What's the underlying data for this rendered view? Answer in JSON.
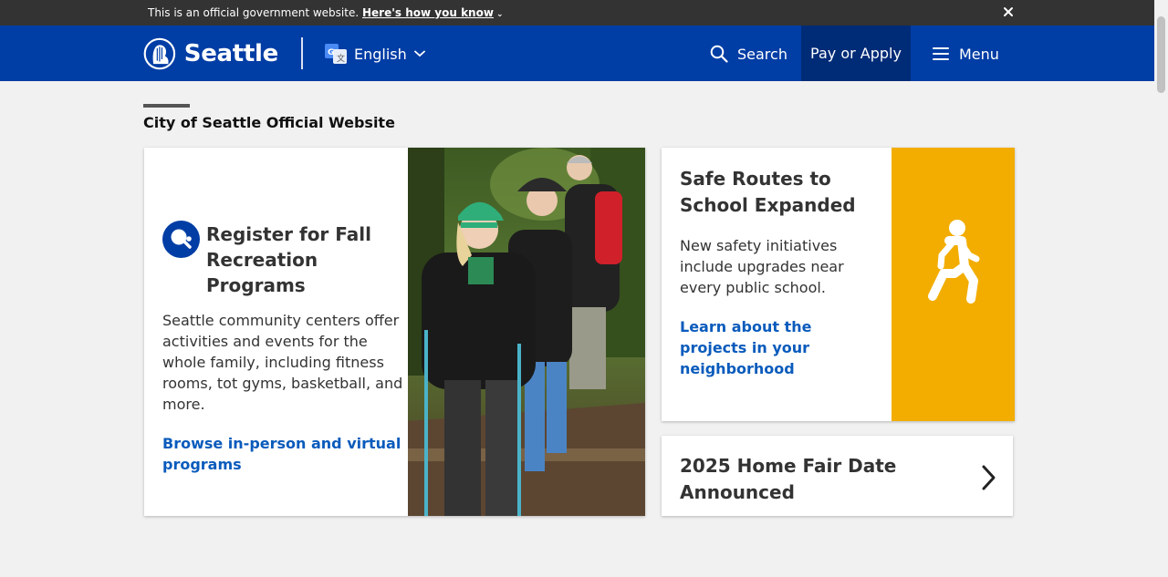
{
  "gov_banner": {
    "text": "This is an official government website.",
    "link": "Here's how you know",
    "chevron_icon": "chevron-down-icon",
    "close_icon": "close-icon"
  },
  "header": {
    "logo_text": "Seattle",
    "language": "English",
    "search_label": "Search",
    "pay_label": "Pay or Apply",
    "menu_label": "Menu"
  },
  "page": {
    "title": "City of Seattle Official Website"
  },
  "features": {
    "main": {
      "icon": "ping-pong-icon",
      "title": "Register for Fall Recreation Programs",
      "body": "Seattle community centers offer activities and events for the whole family, including fitness rooms, tot gyms, basketball, and more.",
      "link": "Browse in-person and virtual programs"
    },
    "safe_routes": {
      "title": "Safe Routes to School Expanded",
      "body": "New safety initiatives include upgrades near every public school.",
      "link": "Learn about the projects in your neighborhood",
      "icon": "walking-person-icon"
    },
    "home_fair": {
      "title": "2025 Home Fair Date Announced",
      "icon": "chevron-right-icon"
    }
  },
  "colors": {
    "header_blue": "#003da5",
    "pay_button": "#002b77",
    "link_blue": "#0a5bbc",
    "safe_panel_yellow": "#f2ad00",
    "gov_banner": "#333333"
  }
}
